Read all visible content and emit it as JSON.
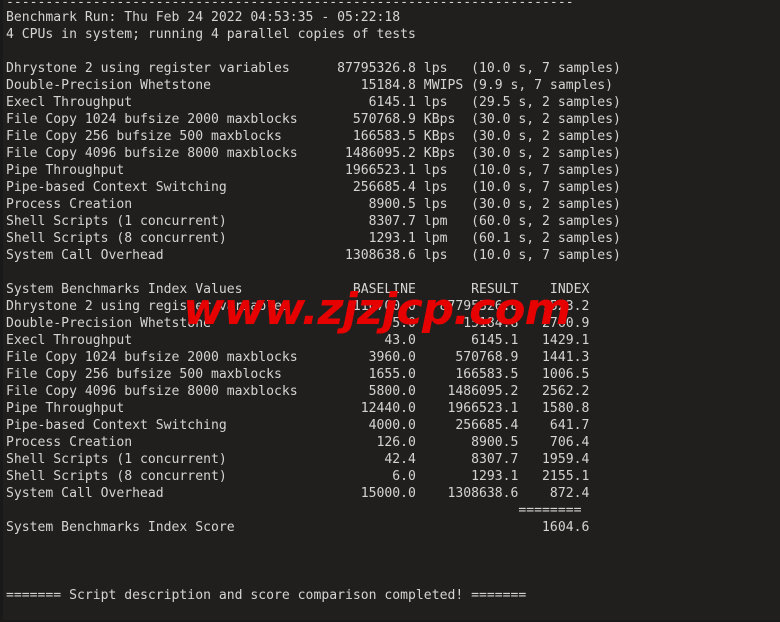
{
  "terminal": {
    "background_color": "#211f1e",
    "text_color": "#d6d4d2",
    "watermark": {
      "text": "www.zjzjcp.com",
      "color": "#e60000"
    }
  },
  "header": {
    "rule": "------------------------------------------------------------------------",
    "run_line": "Benchmark Run: Thu Feb 24 2022 04:53:35 - 05:22:18",
    "cpu_line": "4 CPUs in system; running 4 parallel copies of tests"
  },
  "results": {
    "rows": [
      {
        "name": "Dhrystone 2 using register variables",
        "value": "87795326.8",
        "unit": "lps",
        "timing": "(10.0 s, 7 samples)"
      },
      {
        "name": "Double-Precision Whetstone",
        "value": "15184.8",
        "unit": "MWIPS",
        "timing": "(9.9 s, 7 samples)"
      },
      {
        "name": "Execl Throughput",
        "value": "6145.1",
        "unit": "lps",
        "timing": "(29.5 s, 2 samples)"
      },
      {
        "name": "File Copy 1024 bufsize 2000 maxblocks",
        "value": "570768.9",
        "unit": "KBps",
        "timing": "(30.0 s, 2 samples)"
      },
      {
        "name": "File Copy 256 bufsize 500 maxblocks",
        "value": "166583.5",
        "unit": "KBps",
        "timing": "(30.0 s, 2 samples)"
      },
      {
        "name": "File Copy 4096 bufsize 8000 maxblocks",
        "value": "1486095.2",
        "unit": "KBps",
        "timing": "(30.0 s, 2 samples)"
      },
      {
        "name": "Pipe Throughput",
        "value": "1966523.1",
        "unit": "lps",
        "timing": "(10.0 s, 7 samples)"
      },
      {
        "name": "Pipe-based Context Switching",
        "value": "256685.4",
        "unit": "lps",
        "timing": "(10.0 s, 7 samples)"
      },
      {
        "name": "Process Creation",
        "value": "8900.5",
        "unit": "lps",
        "timing": "(30.0 s, 2 samples)"
      },
      {
        "name": "Shell Scripts (1 concurrent)",
        "value": "8307.7",
        "unit": "lpm",
        "timing": "(60.0 s, 2 samples)"
      },
      {
        "name": "Shell Scripts (8 concurrent)",
        "value": "1293.1",
        "unit": "lpm",
        "timing": "(60.1 s, 2 samples)"
      },
      {
        "name": "System Call Overhead",
        "value": "1308638.6",
        "unit": "lps",
        "timing": "(10.0 s, 7 samples)"
      }
    ]
  },
  "index": {
    "title": "System Benchmarks Index Values",
    "columns": {
      "baseline": "BASELINE",
      "result": "RESULT",
      "index": "INDEX"
    },
    "rows": [
      {
        "name": "Dhrystone 2 using register variables",
        "baseline": "116700.0",
        "result": "87795326.8",
        "index": "7523.2"
      },
      {
        "name": "Double-Precision Whetstone",
        "baseline": "55.0",
        "result": "15184.8",
        "index": "2760.9"
      },
      {
        "name": "Execl Throughput",
        "baseline": "43.0",
        "result": "6145.1",
        "index": "1429.1"
      },
      {
        "name": "File Copy 1024 bufsize 2000 maxblocks",
        "baseline": "3960.0",
        "result": "570768.9",
        "index": "1441.3"
      },
      {
        "name": "File Copy 256 bufsize 500 maxblocks",
        "baseline": "1655.0",
        "result": "166583.5",
        "index": "1006.5"
      },
      {
        "name": "File Copy 4096 bufsize 8000 maxblocks",
        "baseline": "5800.0",
        "result": "1486095.2",
        "index": "2562.2"
      },
      {
        "name": "Pipe Throughput",
        "baseline": "12440.0",
        "result": "1966523.1",
        "index": "1580.8"
      },
      {
        "name": "Pipe-based Context Switching",
        "baseline": "4000.0",
        "result": "256685.4",
        "index": "641.7"
      },
      {
        "name": "Process Creation",
        "baseline": "126.0",
        "result": "8900.5",
        "index": "706.4"
      },
      {
        "name": "Shell Scripts (1 concurrent)",
        "baseline": "42.4",
        "result": "8307.7",
        "index": "1959.4"
      },
      {
        "name": "Shell Scripts (8 concurrent)",
        "baseline": "6.0",
        "result": "1293.1",
        "index": "2155.1"
      },
      {
        "name": "System Call Overhead",
        "baseline": "15000.0",
        "result": "1308638.6",
        "index": "872.4"
      }
    ],
    "separator": "========",
    "score_label": "System Benchmarks Index Score",
    "score_value": "1604.6"
  },
  "footer": {
    "completion_line": "======= Script description and score comparison completed! ======="
  }
}
